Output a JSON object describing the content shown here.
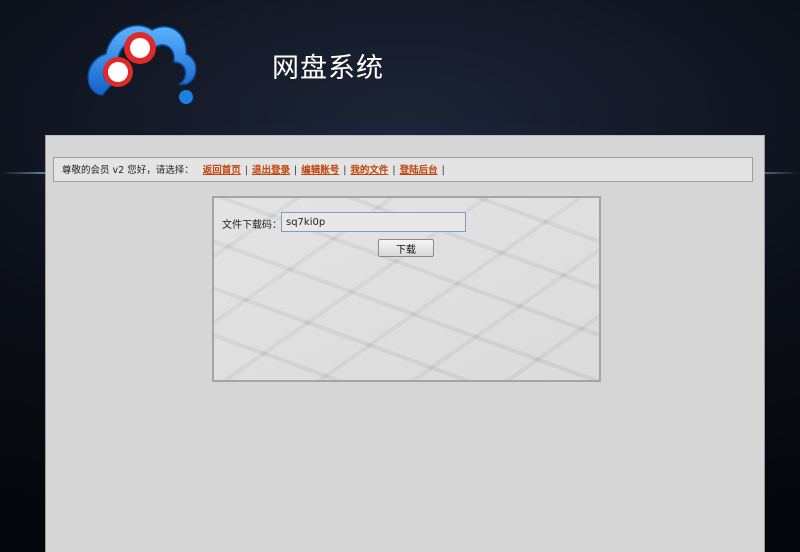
{
  "header": {
    "site_title": "网盘系统"
  },
  "nav": {
    "greeting": "尊敬的会员 v2 您好，请选择：",
    "separator": "|",
    "links": [
      {
        "label": "返回首页"
      },
      {
        "label": "退出登录"
      },
      {
        "label": "编辑账号"
      },
      {
        "label": "我的文件"
      },
      {
        "label": "登陆后台"
      }
    ]
  },
  "download": {
    "label": "文件下载码：",
    "code_value": "sq7ki0p",
    "button_label": "下载"
  },
  "colors": {
    "nav_link": "#c0440c",
    "panel_bg": "#d6d6d6",
    "logo_blue": "#1d7fe0",
    "logo_red": "#e02a2a"
  }
}
